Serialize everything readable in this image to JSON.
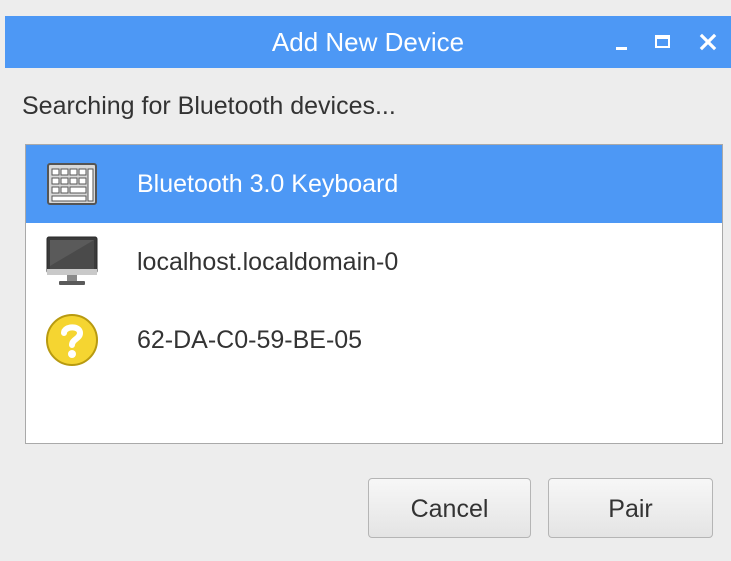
{
  "window": {
    "title": "Add New Device",
    "titlebar_color": "#4d98f5"
  },
  "status_text": "Searching for Bluetooth devices...",
  "devices": [
    {
      "name": "Bluetooth 3.0 Keyboard",
      "icon": "keyboard-icon",
      "selected": true
    },
    {
      "name": "localhost.localdomain-0",
      "icon": "computer-monitor-icon",
      "selected": false
    },
    {
      "name": "62-DA-C0-59-BE-05",
      "icon": "unknown-device-question-icon",
      "selected": false
    }
  ],
  "buttons": {
    "cancel_label": "Cancel",
    "pair_label": "Pair"
  },
  "colors": {
    "selection": "#4d98f5",
    "background": "#ededed",
    "question_icon": "#f5d531"
  }
}
